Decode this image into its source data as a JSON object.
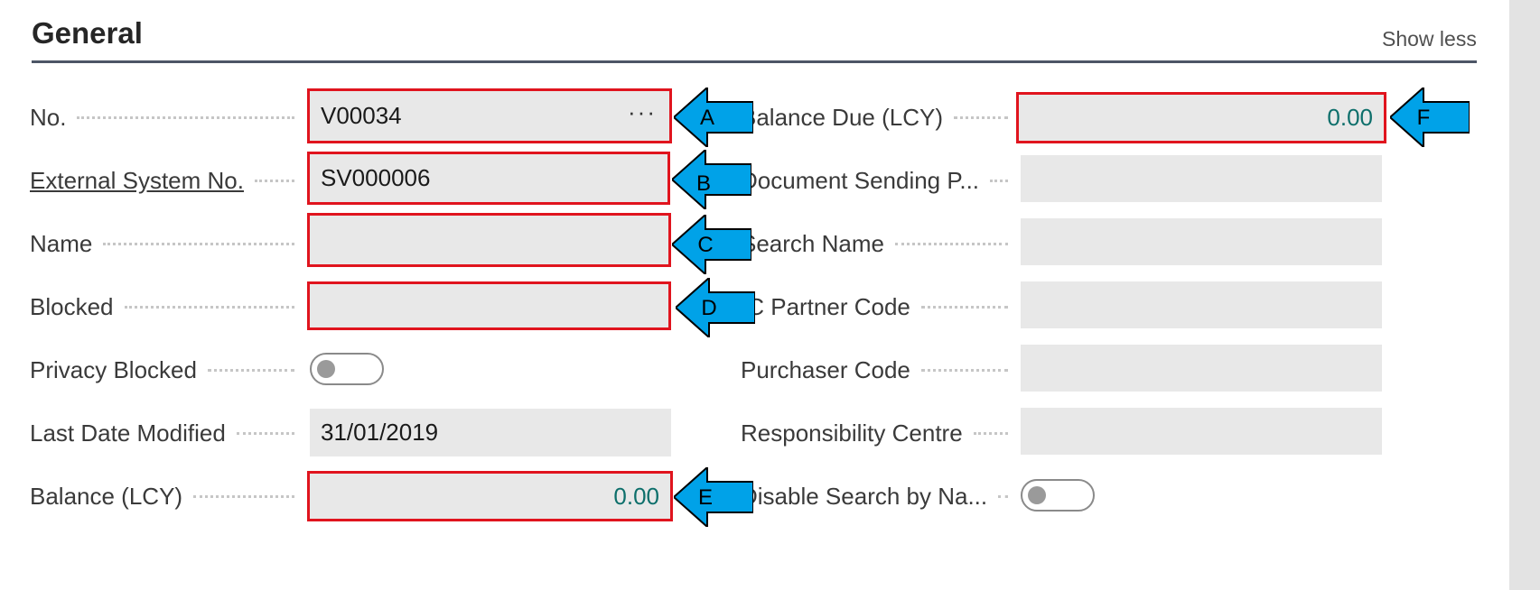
{
  "header": {
    "title": "General",
    "show_less": "Show less"
  },
  "left_fields": {
    "no": {
      "label": "No.",
      "value": "V00034"
    },
    "external_system_no": {
      "label": "External System No.",
      "value": "SV000006"
    },
    "name": {
      "label": "Name",
      "value": ""
    },
    "blocked": {
      "label": "Blocked",
      "value": ""
    },
    "privacy_blocked": {
      "label": "Privacy Blocked",
      "checked": false
    },
    "last_date_modified": {
      "label": "Last Date Modified",
      "value": "31/01/2019"
    },
    "balance_lcy": {
      "label": "Balance (LCY)",
      "value": "0.00"
    }
  },
  "right_fields": {
    "balance_due_lcy": {
      "label": "Balance Due (LCY)",
      "value": "0.00"
    },
    "document_sending_profile": {
      "label": "Document Sending P...",
      "value": ""
    },
    "search_name": {
      "label": "Search Name",
      "value": ""
    },
    "ic_partner_code": {
      "label": "IC Partner Code",
      "value": ""
    },
    "purchaser_code": {
      "label": "Purchaser Code",
      "value": ""
    },
    "responsibility_centre": {
      "label": "Responsibility Centre",
      "value": ""
    },
    "disable_search_by_name": {
      "label": "Disable Search by Na...",
      "checked": false
    }
  },
  "callouts": {
    "a": "A",
    "b": "B",
    "c": "C",
    "d": "D",
    "e": "E",
    "f": "F"
  },
  "icons": {
    "lookup": "ellipsis-icon",
    "scroll": "scroll-up-icon"
  },
  "colors": {
    "highlight": "#e0141e",
    "callout": "#00a2e8",
    "numeric": "#0d6f6b"
  }
}
